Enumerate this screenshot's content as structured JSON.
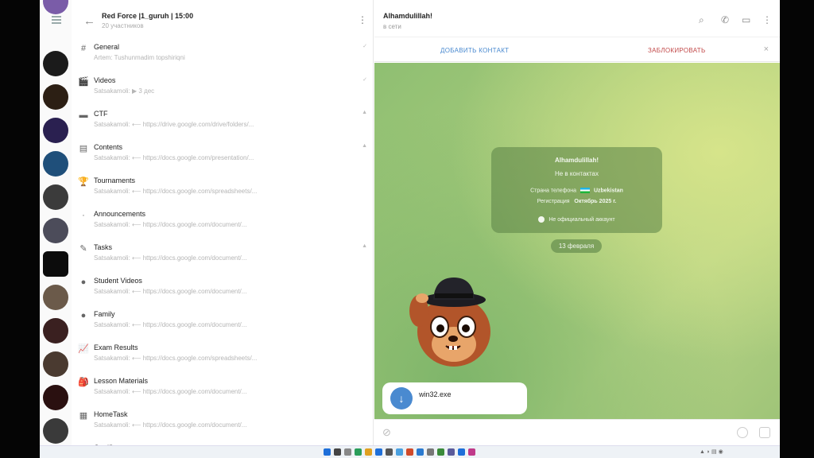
{
  "left": {
    "group_title": "Red Force |1_guruh | 15:00",
    "group_subtitle": "20 участников",
    "topics": [
      {
        "icon": "#",
        "icon_name": "hashtag-icon",
        "name": "General",
        "preview": "Artem: Tushunmadim topshiriqni",
        "mark": "✓"
      },
      {
        "icon": "🎬",
        "icon_name": "clapper-icon",
        "name": "Videos",
        "preview": "Satsakamoli: ▶ 3 дес",
        "mark": "✓"
      },
      {
        "icon": "▬",
        "icon_name": "flag-icon",
        "name": "CTF",
        "preview": "Satsakamoli: ⟵ https://drive.google.com/drive/folders/...",
        "mark": "▲"
      },
      {
        "icon": "▤",
        "icon_name": "document-icon",
        "name": "Contents",
        "preview": "Satsakamoli: ⟵ https://docs.google.com/presentation/...",
        "mark": "▲"
      },
      {
        "icon": "🏆",
        "icon_name": "trophy-icon",
        "name": "Tournaments",
        "preview": "Satsakamoli: ⟵ https://docs.google.com/spreadsheets/...",
        "mark": ""
      },
      {
        "icon": "·",
        "icon_name": "megaphone-icon",
        "name": "Announcements",
        "preview": "Satsakamoli: ⟵ https://docs.google.com/document/...",
        "mark": ""
      },
      {
        "icon": "✎",
        "icon_name": "pencil-icon",
        "name": "Tasks",
        "preview": "Satsakamoli: ⟵ https://docs.google.com/document/...",
        "mark": "▲"
      },
      {
        "icon": "●",
        "icon_name": "video-dot-icon",
        "name": "Student Videos",
        "preview": "Satsakamoli: ⟵ https://docs.google.com/document/...",
        "mark": ""
      },
      {
        "icon": "●",
        "icon_name": "family-dot-icon",
        "name": "Family",
        "preview": "Satsakamoli: ⟵ https://docs.google.com/document/...",
        "mark": ""
      },
      {
        "icon": "📈",
        "icon_name": "chart-icon",
        "name": "Exam Results",
        "preview": "Satsakamoli: ⟵ https://docs.google.com/spreadsheets/...",
        "mark": ""
      },
      {
        "icon": "🎒",
        "icon_name": "bag-icon",
        "name": "Lesson Materials",
        "preview": "Satsakamoli: ⟵ https://docs.google.com/document/...",
        "mark": ""
      },
      {
        "icon": "▦",
        "icon_name": "laptop-icon",
        "name": "HomeTask",
        "preview": "Satsakamoli: ⟵ https://docs.google.com/document/...",
        "mark": ""
      },
      {
        "icon": "·",
        "icon_name": "topic-icon",
        "name": "Certificates",
        "preview": "",
        "mark": ""
      }
    ],
    "rail_colors": [
      "#1b1b1b",
      "#2c1f14",
      "#2a2050",
      "#1f4f7a",
      "#3b3b3b",
      "#4c4c5a",
      "#0c0c0c",
      "#6b5a4a",
      "#3a2020",
      "#4a3a30",
      "#2a1010",
      "#3a3a3a"
    ]
  },
  "chat": {
    "title": "Alhamdulillah!",
    "status": "в сети",
    "add_contact": "ДОБАВИТЬ КОНТАКТ",
    "block": "ЗАБЛОКИРОВАТЬ",
    "card": {
      "title": "Alhamdulillah!",
      "not_contact": "Не в контактах",
      "phone_label": "Страна телефона",
      "phone_value": "Uzbekistan",
      "reg_label": "Регистрация",
      "reg_value": "Октябрь 2025 г.",
      "unofficial": "Не официальный аккаунт"
    },
    "date": "13 февраля",
    "file_name": "win32.exe"
  },
  "colors": {
    "accent": "#4a8ad0",
    "danger": "#c24a4a",
    "chat_bg": "#a9cc7c"
  }
}
